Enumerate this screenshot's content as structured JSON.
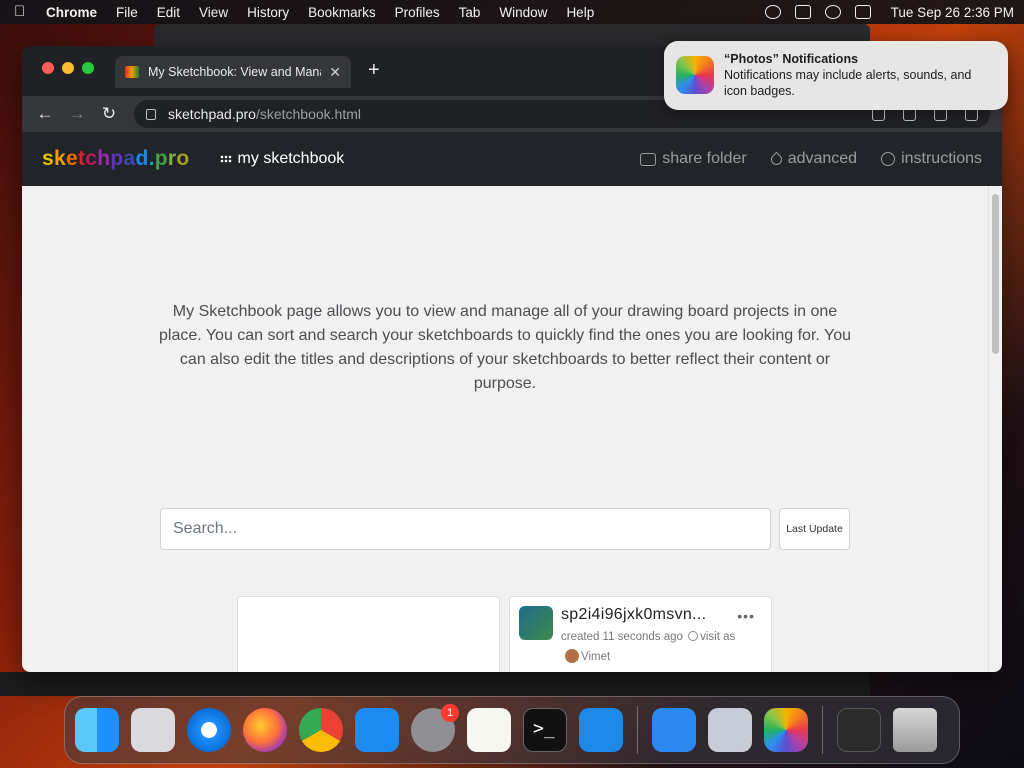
{
  "menubar": {
    "app_name": "Chrome",
    "items": [
      "File",
      "Edit",
      "View",
      "History",
      "Bookmarks",
      "Profiles",
      "Tab",
      "Window",
      "Help"
    ],
    "clock": "Tue Sep 26  2:36 PM"
  },
  "browser": {
    "tab_title": "My Sketchbook: View and Manage",
    "tab_close": "✕",
    "new_tab": "+",
    "url_host": "sketchpad.pro",
    "url_path": "/sketchbook.html"
  },
  "site": {
    "logo_letters": [
      "s",
      "k",
      "e",
      "t",
      "c",
      "h",
      "p",
      "a",
      "d",
      ".",
      "p",
      "r",
      "o"
    ],
    "brand_link": "my sketchbook",
    "nav": {
      "share": "share folder",
      "advanced": "advanced",
      "instructions": "instructions"
    }
  },
  "main": {
    "intro": "My Sketchbook page allows you to view and manage all of your drawing board projects in one place. You can sort and search your sketchboards to quickly find the ones you are looking for. You can also edit the titles and descriptions of your sketchboards to better reflect their content or purpose.",
    "search_placeholder": "Search...",
    "sort_label": "Last Update",
    "card": {
      "title": "sp2i4i96jxk0msvn...",
      "more": "•••",
      "created": "created 11 seconds ago",
      "visit": "visit",
      "as": "as",
      "user": "Vimet"
    }
  },
  "notification": {
    "title": "“Photos” Notifications",
    "body": "Notifications may include alerts, sounds, and icon badges."
  },
  "dock": {
    "settings_badge": "1",
    "terminal_glyph": ">_"
  }
}
